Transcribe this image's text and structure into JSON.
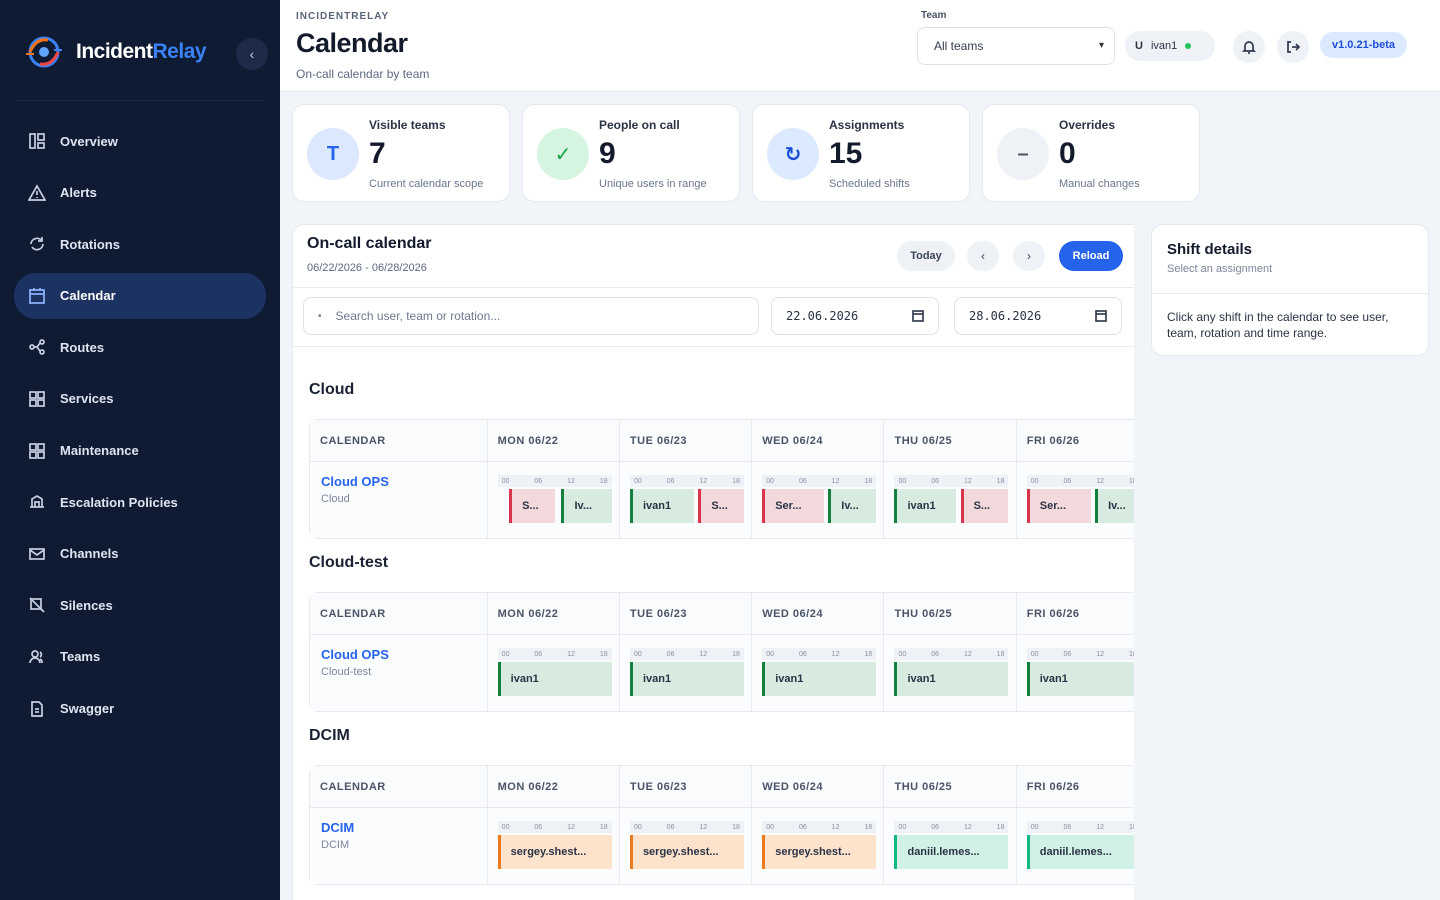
{
  "brand": {
    "name_primary": "Incident",
    "name_accent": "Relay",
    "collapse_glyph": "‹"
  },
  "sidebar": {
    "items": [
      {
        "label": "Overview",
        "icon": "dashboard-icon",
        "active": false
      },
      {
        "label": "Alerts",
        "icon": "warning-icon",
        "active": false
      },
      {
        "label": "Rotations",
        "icon": "rotate-icon",
        "active": false
      },
      {
        "label": "Calendar",
        "icon": "calendar-icon",
        "active": true
      },
      {
        "label": "Routes",
        "icon": "route-icon",
        "active": false
      },
      {
        "label": "Services",
        "icon": "grid-icon",
        "active": false
      },
      {
        "label": "Maintenance",
        "icon": "wrench-icon",
        "active": false
      },
      {
        "label": "Escalation Policies",
        "icon": "layers-icon",
        "active": false
      },
      {
        "label": "Channels",
        "icon": "mail-icon",
        "active": false
      },
      {
        "label": "Silences",
        "icon": "mute-icon",
        "active": false
      },
      {
        "label": "Teams",
        "icon": "users-icon",
        "active": false
      },
      {
        "label": "Swagger",
        "icon": "document-icon",
        "active": false
      }
    ]
  },
  "header": {
    "eyebrow": "INCIDENTRELAY",
    "title": "Calendar",
    "subtitle": "On-call calendar by team",
    "team_label": "Team",
    "team_value": "All teams",
    "user_initial": "U",
    "user_name": "ivan1",
    "version": "v1.0.21-beta"
  },
  "stats": [
    {
      "label": "Visible teams",
      "value": "7",
      "hint": "Current calendar scope",
      "icon_text": "T",
      "icon": "team-letter-icon",
      "bg": "#dbe8fd",
      "fg": "#2563eb"
    },
    {
      "label": "People on call",
      "value": "9",
      "hint": "Unique users in range",
      "icon_text": "✓",
      "icon": "check-icon",
      "bg": "#d6f5e1",
      "fg": "#16a34a"
    },
    {
      "label": "Assignments",
      "value": "15",
      "hint": "Scheduled shifts",
      "icon_text": "↻",
      "icon": "refresh-icon",
      "bg": "#dbeafe",
      "fg": "#1d4ed8"
    },
    {
      "label": "Overrides",
      "value": "0",
      "hint": "Manual changes",
      "icon_text": "–",
      "icon": "override-icon",
      "bg": "#eef1f5",
      "fg": "#4b5568"
    }
  ],
  "calendar": {
    "title": "On-call calendar",
    "range": "06/22/2026 - 06/28/2026",
    "today_label": "Today",
    "prev_glyph": "‹",
    "next_glyph": "›",
    "reload_label": "Reload",
    "search_placeholder": "Search user, team or rotation...",
    "date_from": "22.06.2026",
    "date_to": "28.06.2026",
    "col_header": "CALENDAR",
    "days": [
      "MON 06/22",
      "TUE 06/23",
      "WED 06/24",
      "THU 06/25",
      "FRI 06/26"
    ],
    "hour_marks": [
      "00",
      "06",
      "12",
      "18"
    ],
    "sections": [
      {
        "title": "Cloud",
        "rotation": "Cloud OPS",
        "team": "Cloud",
        "shifts": [
          [
            {
              "label": "S...",
              "color": "red",
              "start": 0.1,
              "end": 0.5
            },
            {
              "label": "Iv...",
              "color": "green",
              "start": 0.56,
              "end": 1.0
            }
          ],
          [
            {
              "label": "ivan1",
              "color": "green",
              "start": 0.0,
              "end": 0.56
            },
            {
              "label": "S...",
              "color": "red",
              "start": 0.6,
              "end": 1.0
            }
          ],
          [
            {
              "label": "Ser...",
              "color": "red",
              "start": 0.0,
              "end": 0.54
            },
            {
              "label": "Iv...",
              "color": "green",
              "start": 0.58,
              "end": 1.0
            }
          ],
          [
            {
              "label": "ivan1",
              "color": "green",
              "start": 0.0,
              "end": 0.54
            },
            {
              "label": "S...",
              "color": "red",
              "start": 0.58,
              "end": 1.0
            }
          ],
          [
            {
              "label": "Ser...",
              "color": "red",
              "start": 0.0,
              "end": 0.56
            },
            {
              "label": "Iv...",
              "color": "green",
              "start": 0.6,
              "end": 1.0
            }
          ]
        ]
      },
      {
        "title": "Cloud-test",
        "rotation": "Cloud OPS",
        "team": "Cloud-test",
        "shifts": [
          [
            {
              "label": "ivan1",
              "color": "green",
              "start": 0.0,
              "end": 1.0
            }
          ],
          [
            {
              "label": "ivan1",
              "color": "green",
              "start": 0.0,
              "end": 1.0
            }
          ],
          [
            {
              "label": "ivan1",
              "color": "green",
              "start": 0.0,
              "end": 1.0
            }
          ],
          [
            {
              "label": "ivan1",
              "color": "green",
              "start": 0.0,
              "end": 1.0
            }
          ],
          [
            {
              "label": "ivan1",
              "color": "green",
              "start": 0.0,
              "end": 1.0
            }
          ]
        ]
      },
      {
        "title": "DCIM",
        "rotation": "DCIM",
        "team": "DCIM",
        "shifts": [
          [
            {
              "label": "sergey.shest...",
              "color": "orange",
              "start": 0.0,
              "end": 1.0
            }
          ],
          [
            {
              "label": "sergey.shest...",
              "color": "orange",
              "start": 0.0,
              "end": 1.0
            }
          ],
          [
            {
              "label": "sergey.shest...",
              "color": "orange",
              "start": 0.0,
              "end": 1.0
            }
          ],
          [
            {
              "label": "daniil.lemes...",
              "color": "teal",
              "start": 0.0,
              "end": 1.0
            }
          ],
          [
            {
              "label": "daniil.lemes...",
              "color": "teal",
              "start": 0.0,
              "end": 1.0
            }
          ]
        ]
      }
    ]
  },
  "details": {
    "title": "Shift details",
    "subtitle": "Select an assignment",
    "body": "Click any shift in the calendar to see user, team, rotation and time range."
  }
}
